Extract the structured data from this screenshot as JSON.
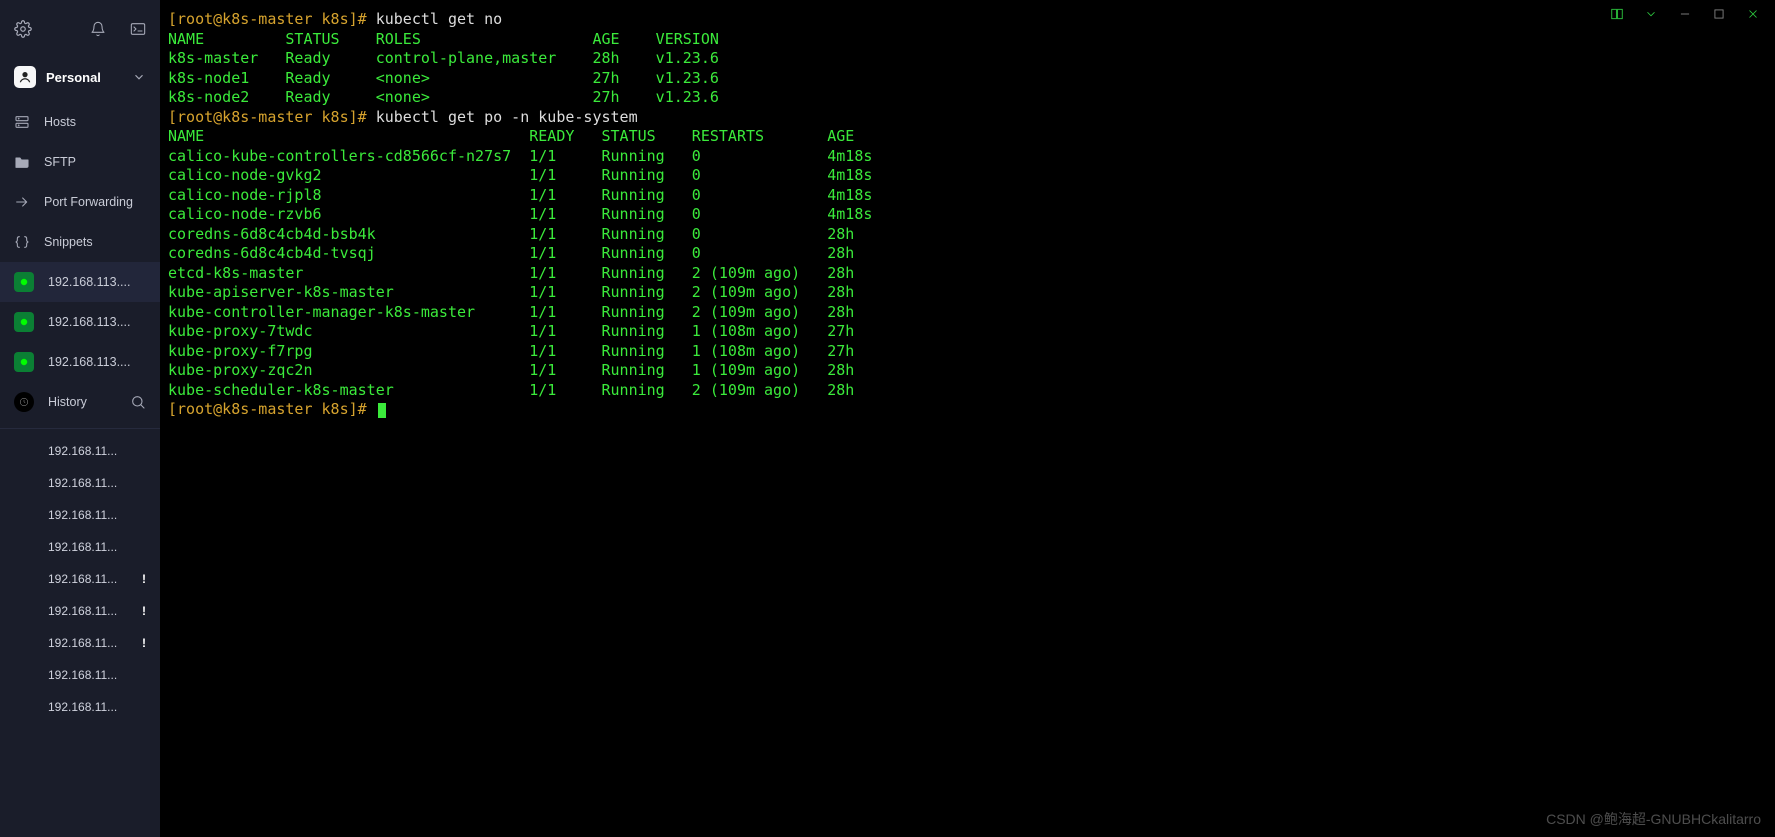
{
  "sidebar": {
    "personal_label": "Personal",
    "nav": [
      {
        "label": "Hosts"
      },
      {
        "label": "SFTP"
      },
      {
        "label": "Port Forwarding"
      },
      {
        "label": "Snippets"
      }
    ],
    "sessions": [
      {
        "label": "192.168.113...."
      },
      {
        "label": "192.168.113...."
      },
      {
        "label": "192.168.113...."
      }
    ],
    "history_label": "History",
    "history_items": [
      {
        "label": "192.168.11...",
        "warn": false
      },
      {
        "label": "192.168.11...",
        "warn": false
      },
      {
        "label": "192.168.11...",
        "warn": false
      },
      {
        "label": "192.168.11...",
        "warn": false
      },
      {
        "label": "192.168.11...",
        "warn": true
      },
      {
        "label": "192.168.11...",
        "warn": true
      },
      {
        "label": "192.168.11...",
        "warn": true
      },
      {
        "label": "192.168.11...",
        "warn": false
      },
      {
        "label": "192.168.11...",
        "warn": false
      }
    ]
  },
  "terminal": {
    "prompt_prefix": "[root@k8s-master k8s]# ",
    "cmd1": "kubectl get no",
    "nodes_header": {
      "name": "NAME",
      "status": "STATUS",
      "roles": "ROLES",
      "age": "AGE",
      "version": "VERSION"
    },
    "nodes": [
      {
        "name": "k8s-master",
        "status": "Ready",
        "roles": "control-plane,master",
        "age": "28h",
        "version": "v1.23.6"
      },
      {
        "name": "k8s-node1",
        "status": "Ready",
        "roles": "<none>",
        "age": "27h",
        "version": "v1.23.6"
      },
      {
        "name": "k8s-node2",
        "status": "Ready",
        "roles": "<none>",
        "age": "27h",
        "version": "v1.23.6"
      }
    ],
    "cmd2": "kubectl get po -n kube-system",
    "pods_header": {
      "name": "NAME",
      "ready": "READY",
      "status": "STATUS",
      "restarts": "RESTARTS",
      "age": "AGE"
    },
    "pods": [
      {
        "name": "calico-kube-controllers-cd8566cf-n27s7",
        "ready": "1/1",
        "status": "Running",
        "restarts": "0",
        "age": "4m18s"
      },
      {
        "name": "calico-node-gvkg2",
        "ready": "1/1",
        "status": "Running",
        "restarts": "0",
        "age": "4m18s"
      },
      {
        "name": "calico-node-rjpl8",
        "ready": "1/1",
        "status": "Running",
        "restarts": "0",
        "age": "4m18s"
      },
      {
        "name": "calico-node-rzvb6",
        "ready": "1/1",
        "status": "Running",
        "restarts": "0",
        "age": "4m18s"
      },
      {
        "name": "coredns-6d8c4cb4d-bsb4k",
        "ready": "1/1",
        "status": "Running",
        "restarts": "0",
        "age": "28h"
      },
      {
        "name": "coredns-6d8c4cb4d-tvsqj",
        "ready": "1/1",
        "status": "Running",
        "restarts": "0",
        "age": "28h"
      },
      {
        "name": "etcd-k8s-master",
        "ready": "1/1",
        "status": "Running",
        "restarts": "2 (109m ago)",
        "age": "28h"
      },
      {
        "name": "kube-apiserver-k8s-master",
        "ready": "1/1",
        "status": "Running",
        "restarts": "2 (109m ago)",
        "age": "28h"
      },
      {
        "name": "kube-controller-manager-k8s-master",
        "ready": "1/1",
        "status": "Running",
        "restarts": "2 (109m ago)",
        "age": "28h"
      },
      {
        "name": "kube-proxy-7twdc",
        "ready": "1/1",
        "status": "Running",
        "restarts": "1 (108m ago)",
        "age": "27h"
      },
      {
        "name": "kube-proxy-f7rpg",
        "ready": "1/1",
        "status": "Running",
        "restarts": "1 (108m ago)",
        "age": "27h"
      },
      {
        "name": "kube-proxy-zqc2n",
        "ready": "1/1",
        "status": "Running",
        "restarts": "1 (109m ago)",
        "age": "28h"
      },
      {
        "name": "kube-scheduler-k8s-master",
        "ready": "1/1",
        "status": "Running",
        "restarts": "2 (109m ago)",
        "age": "28h"
      }
    ]
  },
  "watermark": "CSDN @鲍海超-GNUBHCkalitarro"
}
